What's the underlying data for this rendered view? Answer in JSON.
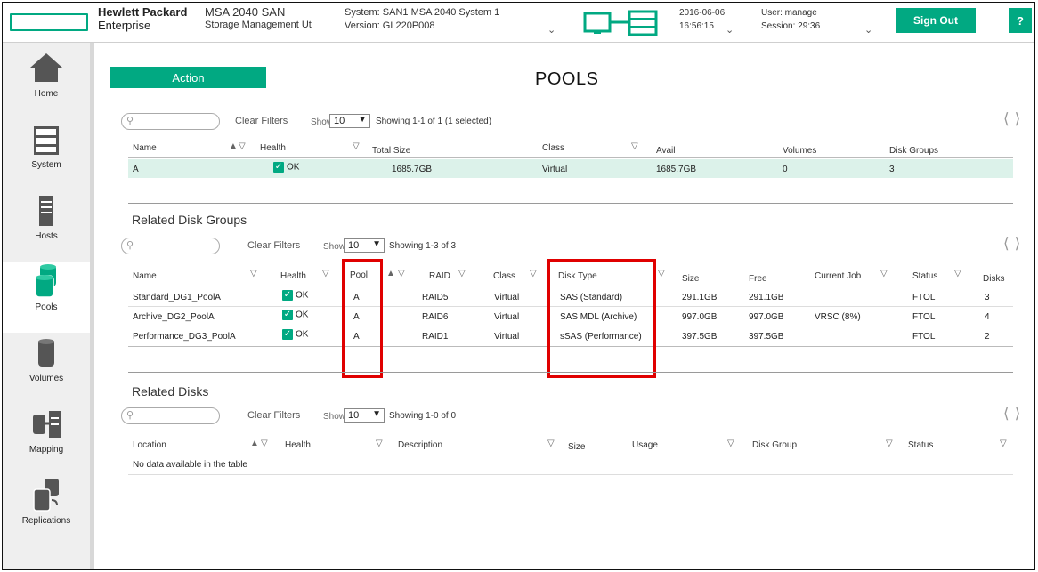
{
  "header": {
    "brand_line1": "Hewlett Packard",
    "brand_line2": "Enterprise",
    "product_line1": "MSA 2040 SAN",
    "product_line2": "Storage Management Ut",
    "system": "System: SAN1 MSA 2040 System 1",
    "version": "Version: GL220P008",
    "date": "2016-06-06",
    "time": "16:56:15",
    "user": "User: manage",
    "session": "Session: 29:36",
    "sign_out": "Sign Out",
    "help": "?"
  },
  "sidebar": {
    "items": [
      {
        "label": "Home",
        "icon": "home-icon"
      },
      {
        "label": "System",
        "icon": "system-icon"
      },
      {
        "label": "Hosts",
        "icon": "hosts-icon"
      },
      {
        "label": "Pools",
        "icon": "pools-icon",
        "active": true
      },
      {
        "label": "Volumes",
        "icon": "volumes-icon"
      },
      {
        "label": "Mapping",
        "icon": "mapping-icon"
      },
      {
        "label": "Replications",
        "icon": "replications-icon"
      }
    ]
  },
  "main": {
    "action": "Action",
    "title": "POOLS",
    "clear_filters": "Clear Filters",
    "show_label": "Show",
    "page_size": "10",
    "pools": {
      "showing": "Showing 1-1 of 1 (1 selected)",
      "columns": [
        "Name",
        "Health",
        "Total Size",
        "Class",
        "Avail",
        "Volumes",
        "Disk Groups"
      ],
      "rows": [
        {
          "name": "A",
          "health": "OK",
          "total_size": "1685.7GB",
          "class": "Virtual",
          "avail": "1685.7GB",
          "volumes": "0",
          "disk_groups": "3"
        }
      ]
    },
    "disk_groups": {
      "title": "Related Disk Groups",
      "showing": "Showing 1-3 of 3",
      "columns": [
        "Name",
        "Health",
        "Pool",
        "RAID",
        "Class",
        "Disk Type",
        "Size",
        "Free",
        "Current Job",
        "Status",
        "Disks"
      ],
      "rows": [
        {
          "name": "Standard_DG1_PoolA",
          "health": "OK",
          "pool": "A",
          "raid": "RAID5",
          "class": "Virtual",
          "disk_type": "SAS (Standard)",
          "size": "291.1GB",
          "free": "291.1GB",
          "job": "",
          "status": "FTOL",
          "disks": "3"
        },
        {
          "name": "Archive_DG2_PoolA",
          "health": "OK",
          "pool": "A",
          "raid": "RAID6",
          "class": "Virtual",
          "disk_type": "SAS MDL (Archive)",
          "size": "997.0GB",
          "free": "997.0GB",
          "job": "VRSC (8%)",
          "status": "FTOL",
          "disks": "4"
        },
        {
          "name": "Performance_DG3_PoolA",
          "health": "OK",
          "pool": "A",
          "raid": "RAID1",
          "class": "Virtual",
          "disk_type": "sSAS (Performance)",
          "size": "397.5GB",
          "free": "397.5GB",
          "job": "",
          "status": "FTOL",
          "disks": "2"
        }
      ]
    },
    "disks": {
      "title": "Related Disks",
      "showing": "Showing 1-0 of 0",
      "columns": [
        "Location",
        "Health",
        "Description",
        "Size",
        "Usage",
        "Disk Group",
        "Status"
      ],
      "empty": "No data available in the table"
    }
  },
  "colors": {
    "accent": "#01a982",
    "highlight": "#e00000",
    "selected_row": "#dcf2ea"
  }
}
